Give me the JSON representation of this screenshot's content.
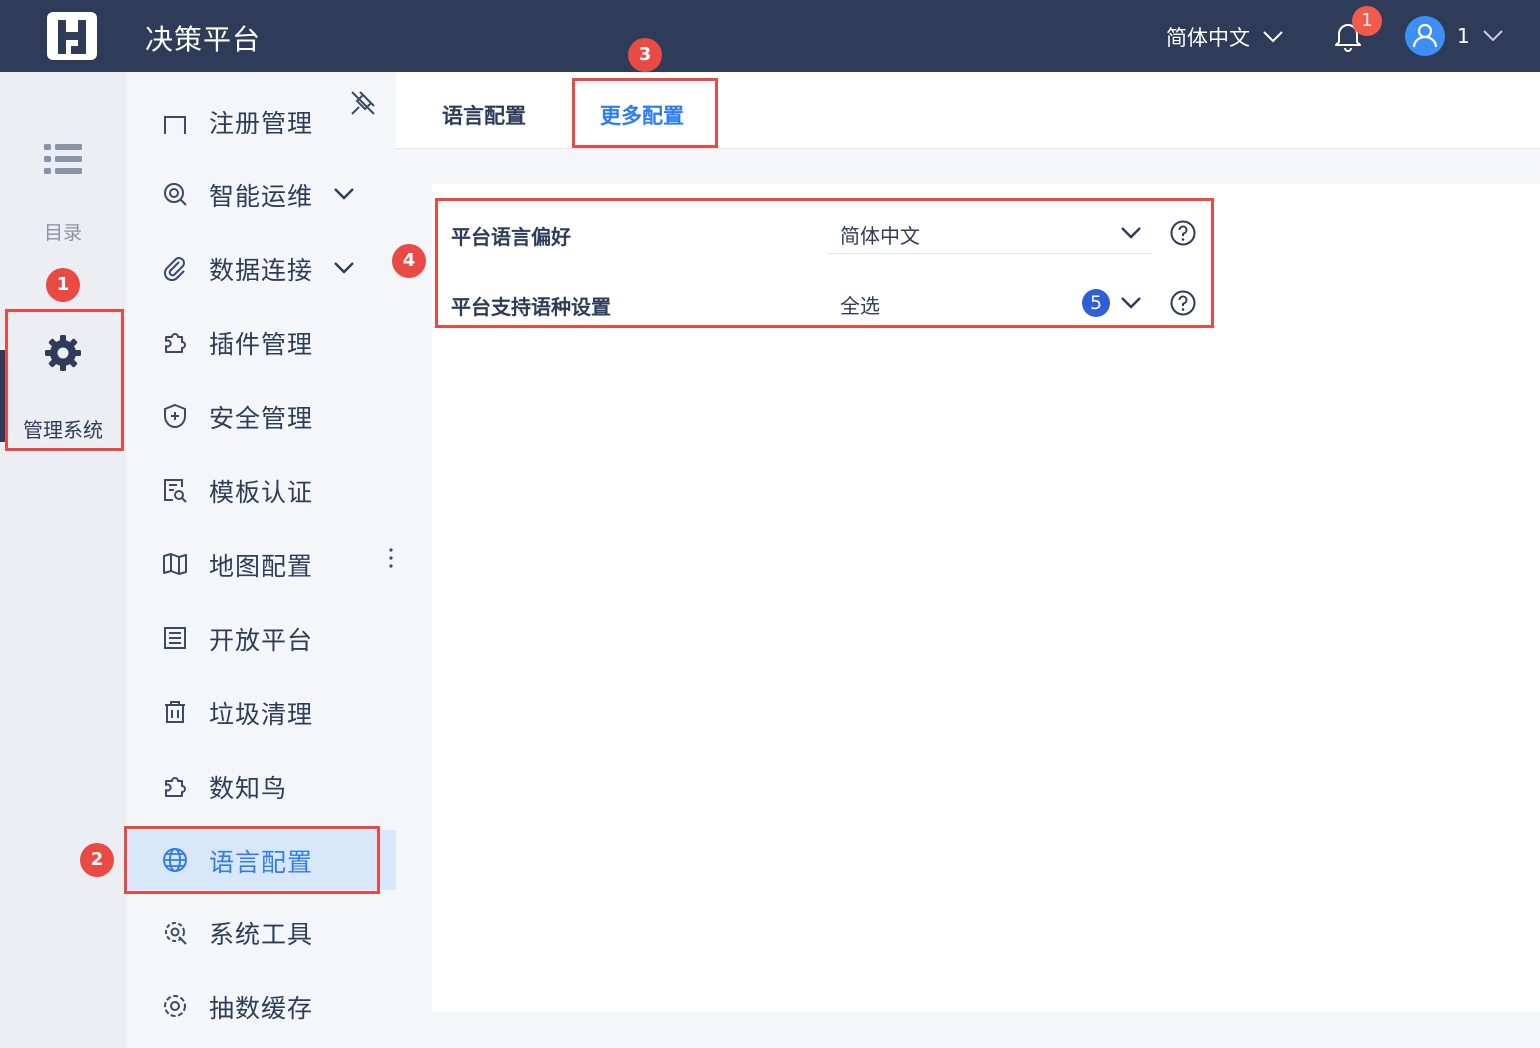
{
  "header": {
    "app_title": "决策平台",
    "language_label": "简体中文",
    "notification_count": "1",
    "user_name": "1"
  },
  "rail": {
    "catalog_label": "目录",
    "admin_label": "管理系统"
  },
  "menu": {
    "items": [
      {
        "label": "注册管理",
        "icon": "register-icon"
      },
      {
        "label": "智能运维",
        "icon": "ops-icon",
        "expandable": true
      },
      {
        "label": "数据连接",
        "icon": "paperclip-icon",
        "expandable": true
      },
      {
        "label": "插件管理",
        "icon": "puzzle-icon"
      },
      {
        "label": "安全管理",
        "icon": "shield-icon"
      },
      {
        "label": "模板认证",
        "icon": "template-cert-icon"
      },
      {
        "label": "地图配置",
        "icon": "map-icon"
      },
      {
        "label": "开放平台",
        "icon": "list-doc-icon"
      },
      {
        "label": "垃圾清理",
        "icon": "trash-icon"
      },
      {
        "label": "数知鸟",
        "icon": "puzzle-icon"
      },
      {
        "label": "语言配置",
        "icon": "globe-icon",
        "active": true
      },
      {
        "label": "系统工具",
        "icon": "tool-gear-icon"
      },
      {
        "label": "抽数缓存",
        "icon": "gear-icon"
      }
    ]
  },
  "tabs": [
    {
      "label": "语言配置",
      "active": false
    },
    {
      "label": "更多配置",
      "active": true
    }
  ],
  "settings": {
    "preference": {
      "label": "平台语言偏好",
      "value": "简体中文"
    },
    "supported": {
      "label": "平台支持语种设置",
      "value": "全选",
      "count": "5"
    }
  },
  "annotations": [
    "1",
    "2",
    "3",
    "4"
  ],
  "colors": {
    "header_bg": "#2e3c5a",
    "accent": "#2f7cf0",
    "annotation_red": "#e94a43",
    "active_menu_bg": "#d9e7fb"
  }
}
